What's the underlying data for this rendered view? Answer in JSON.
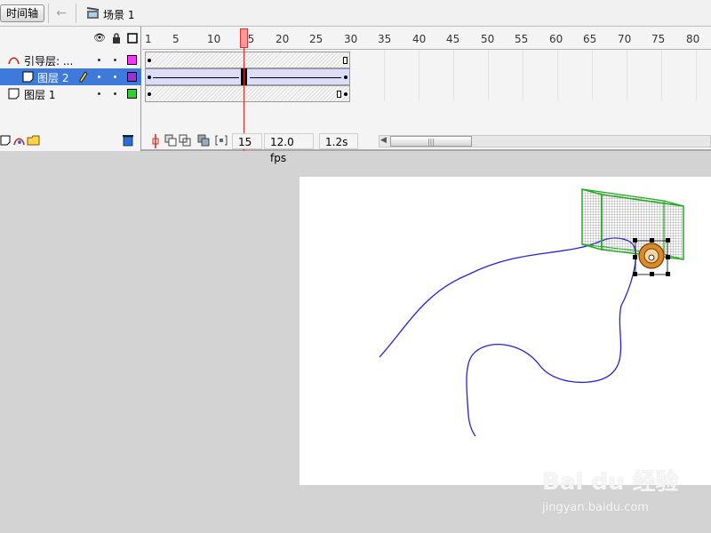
{
  "toolbar": {
    "timeline_button": "时间轴",
    "scene_label": "场景 1"
  },
  "layers": [
    {
      "name": "引导层: ...",
      "type": "guide",
      "color": "#ff33ff",
      "selected": false
    },
    {
      "name": "图层 2",
      "type": "normal",
      "color": "#9933cc",
      "selected": true
    },
    {
      "name": "图层 1",
      "type": "normal",
      "color": "#33cc33",
      "selected": false
    }
  ],
  "ruler": {
    "labels": [
      "1",
      "5",
      "10",
      "15",
      "20",
      "25",
      "30",
      "35",
      "40",
      "45",
      "50",
      "55",
      "60",
      "65",
      "70",
      "75",
      "80"
    ]
  },
  "status": {
    "current_frame": "15",
    "frame_rate": "12.0 fps",
    "elapsed": "1.2s"
  },
  "watermark": {
    "main": "Bai du 经验",
    "sub": "jingyan.baidu.com"
  },
  "colors": {
    "guide_path": "#2222dd",
    "goal_net": "#22aa22",
    "selection_layer": "#3d7ad9"
  }
}
